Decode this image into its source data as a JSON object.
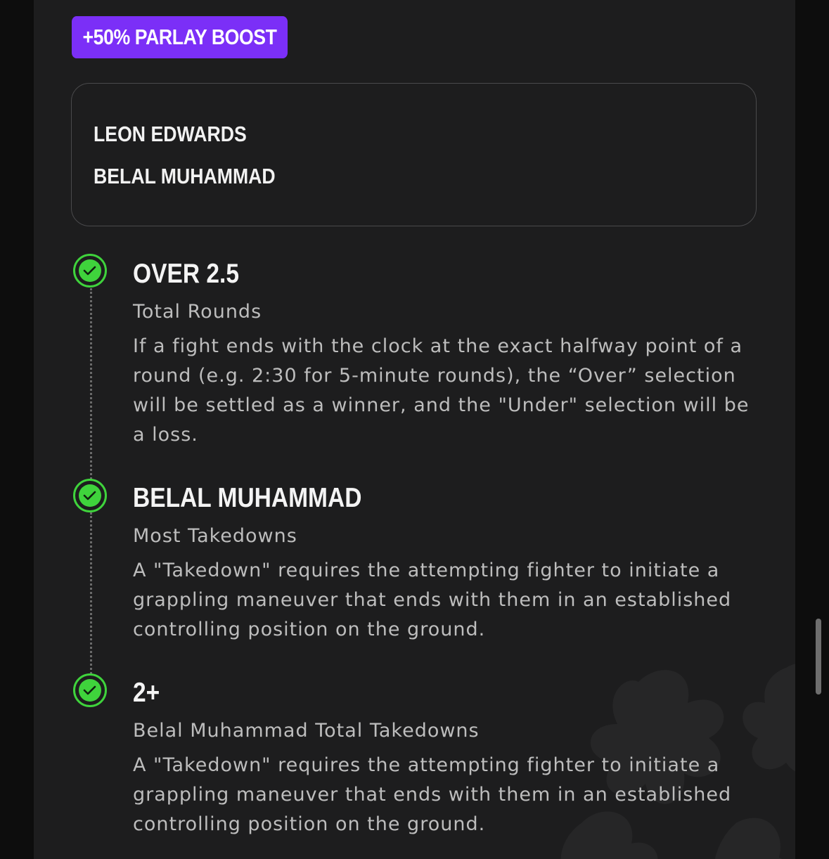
{
  "boost": {
    "label": "+50% PARLAY BOOST"
  },
  "fighters": [
    "LEON EDWARDS",
    "BELAL MUHAMMAD"
  ],
  "legs": [
    {
      "selection": "OVER 2.5",
      "market": "Total Rounds",
      "description": "If a fight ends with the clock at the exact halfway point of a round (e.g. 2:30 for 5-minute rounds), the “Over” selection will be settled as a winner, and the \"Under\" selection will be a loss.",
      "status": "won"
    },
    {
      "selection": "BELAL MUHAMMAD",
      "market": "Most Takedowns",
      "description": "A \"Takedown\" requires the attempting fighter to initiate a grappling maneuver that ends with them in an established controlling position on the ground.",
      "status": "won"
    },
    {
      "selection": "2+",
      "market": "Belal Muhammad Total Takedowns",
      "description": "A \"Takedown\" requires the attempting fighter to initiate a grappling maneuver that ends with them in an established controlling position on the ground.",
      "status": "won"
    }
  ],
  "icons": {
    "status": "check-circle-icon",
    "background": "floral-pattern"
  },
  "colors": {
    "boost": "#7b2ff7",
    "check": "#3fd33c",
    "panel": "#1d1d1e",
    "background": "#0d0d0d"
  }
}
